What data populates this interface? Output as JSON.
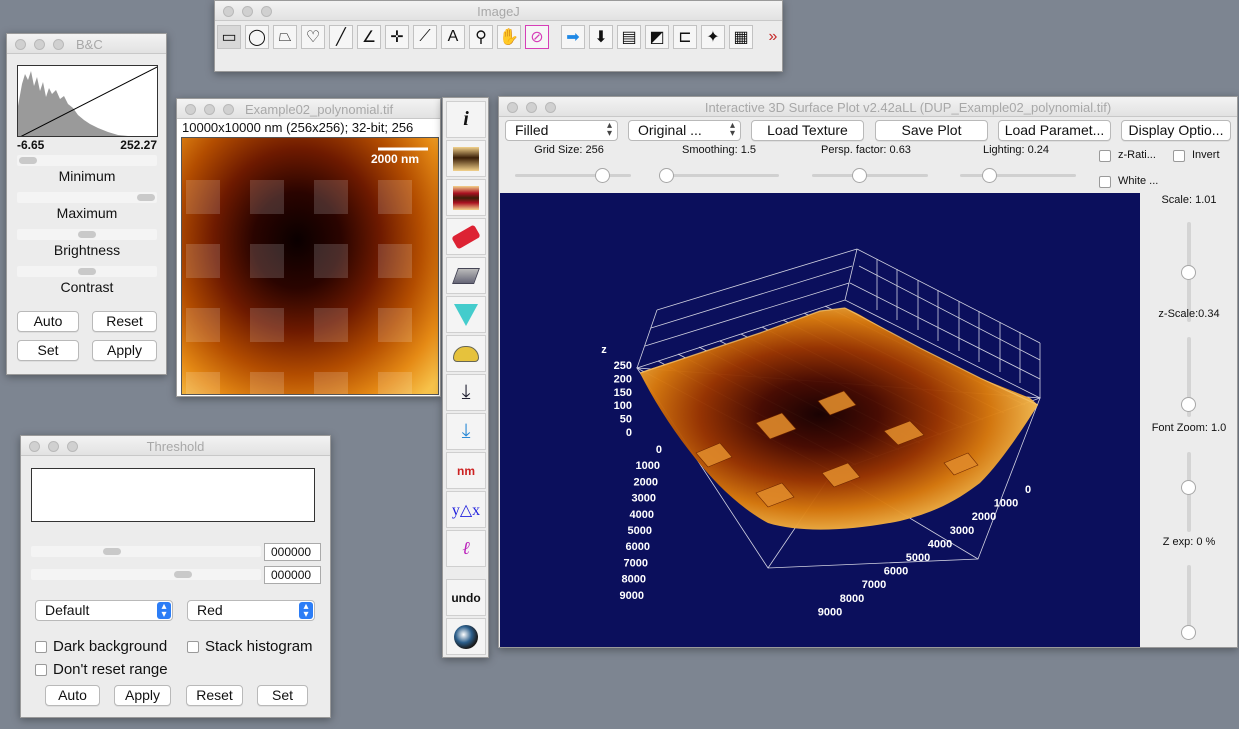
{
  "imagej": {
    "title": "ImageJ",
    "tools": [
      {
        "name": "rectangle-tool-icon",
        "glyph": "▭"
      },
      {
        "name": "oval-tool-icon",
        "glyph": "◯"
      },
      {
        "name": "polygon-tool-icon",
        "glyph": "⏢"
      },
      {
        "name": "freehand-tool-icon",
        "glyph": "♡"
      },
      {
        "name": "line-tool-icon",
        "glyph": "╱"
      },
      {
        "name": "angle-tool-icon",
        "glyph": "∠"
      },
      {
        "name": "point-tool-icon",
        "glyph": "✛"
      },
      {
        "name": "wand-tool-icon",
        "glyph": "⟋"
      },
      {
        "name": "text-tool-icon",
        "glyph": "A"
      },
      {
        "name": "magnifier-tool-icon",
        "glyph": "⚲"
      },
      {
        "name": "hand-tool-icon",
        "glyph": "✋"
      },
      {
        "name": "dropper-tool-icon",
        "glyph": "⊘"
      },
      {
        "name": "arrow-right-tool-icon",
        "glyph": "➡"
      },
      {
        "name": "arrow-down-tool-icon",
        "glyph": "⬇"
      },
      {
        "name": "lut-tool-icon",
        "glyph": "▤"
      },
      {
        "name": "gradient-tool-icon",
        "glyph": "◩"
      },
      {
        "name": "stamp-tool-icon",
        "glyph": "⊏"
      },
      {
        "name": "star-tool-icon",
        "glyph": "✦"
      },
      {
        "name": "color-picker-tool-icon",
        "glyph": "▦"
      },
      {
        "name": "more-tools-icon",
        "glyph": "»"
      }
    ]
  },
  "bc": {
    "title": "B&C",
    "min_value": "-6.65",
    "max_value": "252.27",
    "minimum_label": "Minimum",
    "maximum_label": "Maximum",
    "brightness_label": "Brightness",
    "contrast_label": "Contrast",
    "auto": "Auto",
    "reset": "Reset",
    "set": "Set",
    "apply": "Apply"
  },
  "image": {
    "title": "Example02_polynomial.tif",
    "info": "10000x10000 nm (256x256); 32-bit; 256",
    "scalebar": "2000 nm"
  },
  "threshold": {
    "title": "Threshold",
    "value1": "000000",
    "value2": "000000",
    "method": "Default",
    "mode": "Red",
    "dark_background": "Dark background",
    "stack_histogram": "Stack histogram",
    "dont_reset": "Don't reset range",
    "auto": "Auto",
    "apply": "Apply",
    "reset": "Reset",
    "set": "Set"
  },
  "sidetools": {
    "info": "i",
    "undo": "undo"
  },
  "plot": {
    "title": "Interactive 3D Surface Plot v2.42aLL  (DUP_Example02_polynomial.tif)",
    "mode": "Filled",
    "colors": "Original ...",
    "load_texture": "Load Texture",
    "save_plot": "Save Plot",
    "load_params": "Load Paramet...",
    "display_options": "Display Optio...",
    "grid_size": "Grid Size: 256",
    "smoothing": "Smoothing: 1.5",
    "persp": "Persp. factor: 0.63",
    "lighting": "Lighting: 0.24",
    "z_ratio": "z-Rati...",
    "invert": "Invert",
    "white": "White ...",
    "scale": "Scale: 1.01",
    "z_scale": "z-Scale:0.34",
    "font_zoom": "Font Zoom: 1.0",
    "z_exp": "Z exp: 0 %",
    "z_axis_label": "z",
    "z_ticks": [
      "250",
      "200",
      "150",
      "100",
      "50",
      "0"
    ],
    "x_ticks": [
      "0",
      "1000",
      "2000",
      "3000",
      "4000",
      "5000",
      "6000",
      "7000",
      "8000",
      "9000"
    ],
    "y_ticks": [
      "0",
      "1000",
      "2000",
      "3000",
      "4000",
      "5000",
      "6000",
      "7000",
      "8000",
      "9000"
    ]
  },
  "colors": {
    "plot_bg": "#0b0f5c",
    "accent_magenta": "#d63fb8"
  }
}
